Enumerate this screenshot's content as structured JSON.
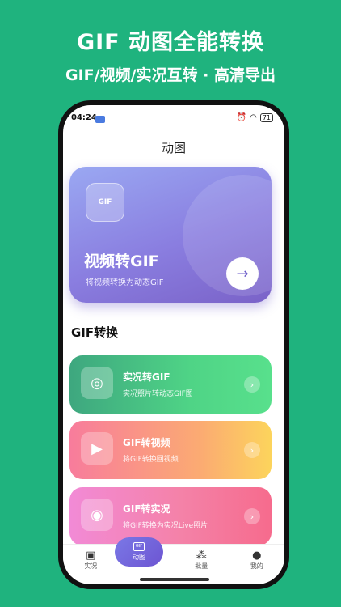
{
  "promo": {
    "title": "GIF 动图全能转换",
    "subtitle": "GIF/视频/实况互转 · 高清导出"
  },
  "status_bar": {
    "time": "04:24",
    "icons": [
      "alarm-icon",
      "wifi-icon",
      "signal-icon"
    ],
    "battery": "71"
  },
  "nav": {
    "title": "动图"
  },
  "hero": {
    "icon_label": "GIF",
    "title": "视频转GIF",
    "subtitle": "将视频转换为动态GIF",
    "arrow": "→"
  },
  "section": {
    "title": "GIF转换"
  },
  "cards": [
    {
      "title": "实况转GIF",
      "subtitle": "实况照片转动态GIF图",
      "icon": "live-photo-icon",
      "glyph": "◎",
      "chevron": "›"
    },
    {
      "title": "GIF转视频",
      "subtitle": "将GIF转换回视频",
      "icon": "video-icon",
      "glyph": "▶",
      "chevron": "›"
    },
    {
      "title": "GIF转实况",
      "subtitle": "将GIF转换为实况Live照片",
      "icon": "camera-icon",
      "glyph": "◉",
      "chevron": "›"
    }
  ],
  "tabs": [
    {
      "label": "实况",
      "icon": "image-icon",
      "glyph": "▣"
    },
    {
      "label": "动图",
      "icon": "gif-icon",
      "glyph": "GIF"
    },
    {
      "label": "批量",
      "icon": "batch-icon",
      "glyph": "⁂"
    },
    {
      "label": "我的",
      "icon": "person-icon",
      "glyph": "●"
    }
  ],
  "colors": {
    "background": "#1fb37e",
    "accent": "#6d55d2"
  }
}
